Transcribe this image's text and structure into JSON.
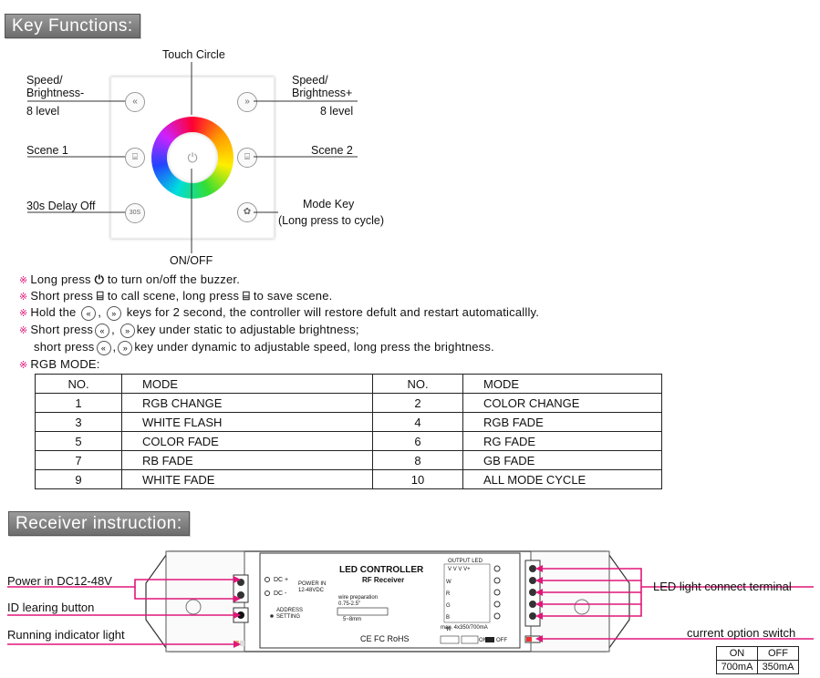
{
  "headers": {
    "key_functions": "Key Functions:",
    "receiver": "Receiver instruction:"
  },
  "remote": {
    "touch_circle": "Touch Circle",
    "speed_minus": "Speed/",
    "speed_minus_2": "Brightness-",
    "speed_minus_3": "8 level",
    "speed_plus": "Speed/",
    "speed_plus_2": "Brightness+",
    "speed_plus_3": "8 level",
    "scene1": "Scene 1",
    "scene2": "Scene 2",
    "delay": "30s Delay Off",
    "mode_key": "Mode Key",
    "mode_key_2": "(Long press to cycle)",
    "onoff": "ON/OFF",
    "btn_30s": "30S",
    "btn_prev": "«",
    "btn_next": "»"
  },
  "notes": {
    "n1a": "Long press",
    "n1b": "to turn on/off the buzzer.",
    "n2a": "Short press",
    "n2b": "to call scene, long press",
    "n2c": "to save scene.",
    "n3a": "Hold the",
    "n3b": ",",
    "n3c": "keys for 2 second, the controller will restore defult and restart automaticallly.",
    "n4a": "Short press",
    "n4b": ",",
    "n4c": "key under static to adjustable brightness;",
    "n5a": "short press",
    "n5b": ",",
    "n5c": "key under dynamic to  adjustable speed, long press the brightness.",
    "n6": "RGB MODE:",
    "mark": "※"
  },
  "modes": {
    "headers": [
      "NO.",
      "MODE",
      "NO.",
      "MODE"
    ],
    "rows": [
      [
        "1",
        "RGB CHANGE",
        "2",
        "COLOR CHANGE"
      ],
      [
        "3",
        "WHITE FLASH",
        "4",
        "RGB FADE"
      ],
      [
        "5",
        "COLOR FADE",
        "6",
        "RG FADE"
      ],
      [
        "7",
        "RB FADE",
        "8",
        "GB FADE"
      ],
      [
        "9",
        "WHITE FADE",
        "10",
        "ALL MODE CYCLE"
      ]
    ]
  },
  "receiver": {
    "power": "Power in DC12-48V",
    "id_clear": "ID learing button",
    "running": "Running indicator light",
    "led_terminal": "LED light connect terminal",
    "option_switch": "current option switch",
    "title": "LED CONTROLLER",
    "subtitle": "RF Receiver",
    "dc_plus": "DC +",
    "dc_minus": "DC -",
    "power_in": "POWER IN",
    "power_range": "12-48VDC",
    "address": "ADDRESS",
    "setting": "SETTING",
    "wire_prep": "wire preparation",
    "wire_gauge": "0.75-2.5\"",
    "strip": "5~8mm",
    "output_led": "OUTPUT LED",
    "max": "max. 4x350/700mA",
    "certs": "CE FC RoHS",
    "on_off": "ON",
    "off": "OFF",
    "terminals_v": [
      "V",
      "V",
      "V",
      "V+"
    ],
    "terminals_rgbw": [
      "W",
      "R",
      "G",
      "B",
      "W"
    ],
    "option_table": [
      [
        "ON",
        "OFF"
      ],
      [
        "700mA",
        "350mA"
      ]
    ]
  }
}
